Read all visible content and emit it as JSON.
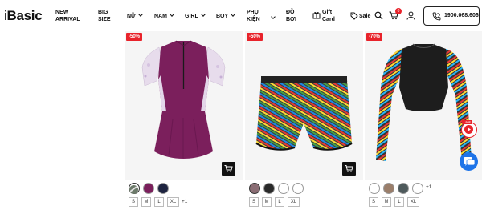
{
  "brand": {
    "logo_prefix": "i",
    "logo_main": "Basic"
  },
  "nav": {
    "items": [
      {
        "label_lines": [
          "NEW",
          "ARRIVAL"
        ]
      },
      {
        "label_lines": [
          "BIG",
          "SIZE"
        ]
      },
      {
        "label_lines": [
          "NỮ"
        ],
        "dropdown": true
      },
      {
        "label_lines": [
          "NAM"
        ],
        "dropdown": true
      },
      {
        "label_lines": [
          "GIRL"
        ],
        "dropdown": true
      },
      {
        "label_lines": [
          "BOY"
        ],
        "dropdown": true
      },
      {
        "label_lines": [
          "PHỤ",
          "KIỆN"
        ],
        "dropdown": true
      },
      {
        "label_lines": [
          "ĐỒ",
          "BƠI"
        ]
      }
    ],
    "gift_card": {
      "line1": "Gift",
      "line2": "Card"
    },
    "sale": "Sale",
    "cart_count": "0",
    "hotline": "1900.068.606"
  },
  "products": [
    {
      "discount": "-50%",
      "swatches": [
        {
          "color": "#6c7a6a",
          "selected": true
        },
        {
          "color": "#7b1f5c",
          "selected": false
        },
        {
          "color": "#1e2440",
          "selected": false
        }
      ],
      "sizes": [
        "S",
        "M",
        "L",
        "XL"
      ],
      "more_sizes": "+1"
    },
    {
      "discount": "-50%",
      "swatches": [
        {
          "color": "#8a6d74",
          "selected": true
        },
        {
          "color": "#2a2a2a",
          "selected": false
        },
        {
          "color": "#ffffff",
          "selected": false
        },
        {
          "color": "#ffffff",
          "selected": false
        }
      ],
      "sizes": [
        "S",
        "M",
        "L",
        "XL"
      ],
      "more_sizes": ""
    },
    {
      "discount": "-70%",
      "swatches": [
        {
          "color": "#ffffff",
          "selected": false
        },
        {
          "color": "#9a7e6a",
          "selected": false
        },
        {
          "color": "#4e5a5c",
          "selected": false
        },
        {
          "color": "#ffffff",
          "selected": false
        }
      ],
      "sizes": [
        "S",
        "M",
        "L",
        "XL"
      ],
      "more_sizes": "+1"
    }
  ],
  "floating": {
    "live": "LIVE"
  },
  "colors": {
    "accent_red": "#e8232b",
    "chat_blue": "#1e74e8"
  }
}
